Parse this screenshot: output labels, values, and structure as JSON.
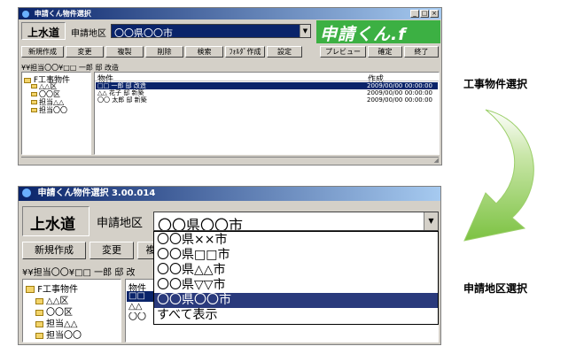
{
  "captions": {
    "top": "工事物件選択",
    "bottom": "申請地区選択"
  },
  "colors": {
    "title_bar": "#0a246a",
    "selection": "#0a246a",
    "arrow": "#7cc242",
    "logo_green": "#3cb043"
  },
  "top_window": {
    "title": "申請くん物件選択",
    "company": "上水道",
    "district_label": "申請地区",
    "district_value": "〇〇県〇〇市",
    "logo": "申請くん.f",
    "toolbar": [
      "新規作成",
      "変更",
      "複製",
      "削除",
      "検索",
      "ﾌｫﾙﾀﾞ作成",
      "設定"
    ],
    "toolbar_right": [
      "プレビュー",
      "確定",
      "終了"
    ],
    "path": "¥¥担当〇〇¥□□ 一郎 邸 改造",
    "tree_root": "F工事物件",
    "tree": [
      "△△区",
      "〇〇区",
      "担当△△",
      "担当〇〇"
    ],
    "col_name": "物件",
    "col_date": "作成",
    "rows": [
      {
        "name": "□□ 一郎 邸 改造",
        "date": "2009/00/00 00:00:00"
      },
      {
        "name": "△△ 花子 邸 新築",
        "date": "2009/00/00 00:00:00"
      },
      {
        "name": "〇〇 太郎 邸 新築",
        "date": "2009/00/00 00:00:00"
      }
    ]
  },
  "bottom_window": {
    "title": "申請くん物件選択 3.00.014",
    "company": "上水道",
    "district_label": "申請地区",
    "district_value": "〇〇県〇〇市",
    "toolbar": [
      "新規作成",
      "変更",
      "複"
    ],
    "path": "¥¥担当〇〇¥□□ 一郎 邸 改",
    "tree_root": "F工事物件",
    "tree": [
      "△△区",
      "〇〇区",
      "担当△△",
      "担当〇〇"
    ],
    "col_name": "物件",
    "row_marks": [
      "□□",
      "△△",
      "〇〇"
    ],
    "dropdown": [
      "〇〇県××市",
      "〇〇県□□市",
      "〇〇県△△市",
      "〇〇県▽▽市",
      "〇〇県〇〇市",
      "すべて表示"
    ],
    "dropdown_selected_index": 4
  }
}
